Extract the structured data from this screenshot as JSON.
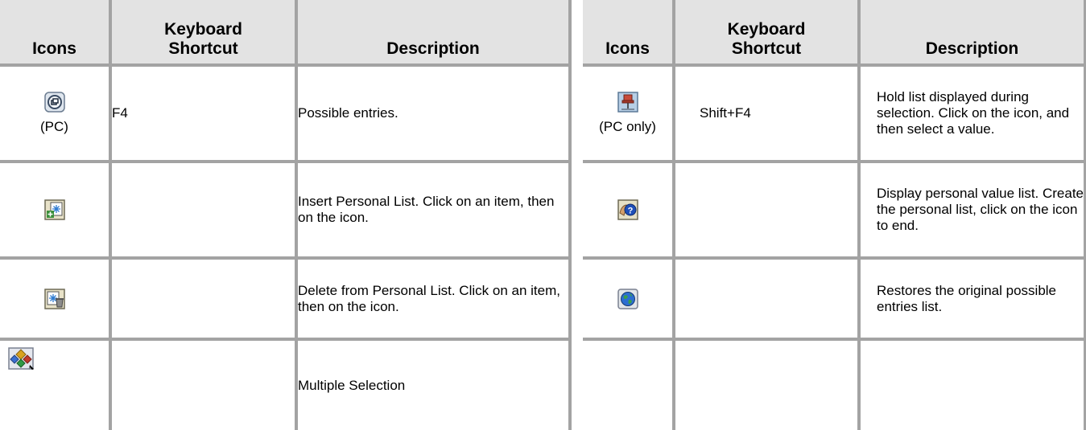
{
  "headers": {
    "icons": "Icons",
    "shortcut_line1": "Keyboard",
    "shortcut_line2": "Shortcut",
    "description": "Description"
  },
  "left_rows": [
    {
      "icon": "possible-entries-icon",
      "note": "(PC)",
      "shortcut": "F4",
      "description": "Possible entries."
    },
    {
      "icon": "insert-personal-list-icon",
      "note": "",
      "shortcut": "",
      "description": "Insert Personal List. Click on an item, then on the icon."
    },
    {
      "icon": "delete-personal-list-icon",
      "note": "",
      "shortcut": "",
      "description": "Delete from Personal List. Click on an item, then on the icon."
    },
    {
      "icon": "multiple-selection-icon",
      "note": "",
      "shortcut": "",
      "description": "Multiple Selection"
    }
  ],
  "right_rows": [
    {
      "icon": "hold-list-pin-icon",
      "note": "(PC only)",
      "shortcut": "Shift+F4",
      "description": "Hold list displayed during selection. Click on the icon, and then select a value."
    },
    {
      "icon": "personal-value-list-icon",
      "note": "",
      "shortcut": "",
      "description": "Display personal value list. Create the personal list, click on the icon to end."
    },
    {
      "icon": "restore-globe-icon",
      "note": "",
      "shortcut": "",
      "description": "Restores the original possible entries list."
    },
    {
      "icon": "",
      "note": "",
      "shortcut": "",
      "description": ""
    }
  ]
}
